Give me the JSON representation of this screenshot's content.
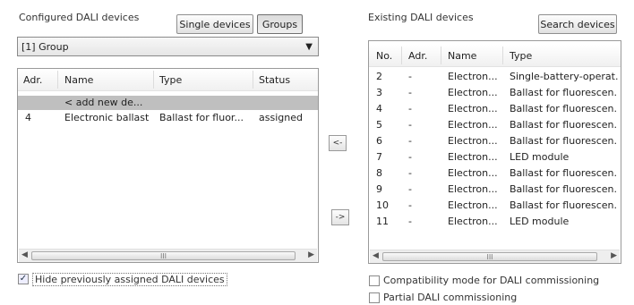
{
  "left": {
    "title": "Configured DALI devices",
    "single_devices_label": "Single devices",
    "groups_label": "Groups",
    "group_combo_value": "[1] Group",
    "columns": [
      "Adr.",
      "Name",
      "Type",
      "Status"
    ],
    "rows": [
      {
        "adr": "",
        "name": "< add new de...",
        "type": "",
        "status": ""
      },
      {
        "adr": "4",
        "name": "Electronic ballast",
        "type": "Ballast for fluor...",
        "status": "assigned"
      }
    ],
    "hide_checkbox_label": "Hide previously assigned DALI devices",
    "hide_checked": true,
    "scroll_thumb_glyph": "III"
  },
  "middle": {
    "move_left_label": "<-",
    "move_right_label": "->"
  },
  "right": {
    "title": "Existing DALI devices",
    "search_label": "Search devices",
    "columns": [
      "No.",
      "Adr.",
      "Name",
      "Type"
    ],
    "rows": [
      {
        "no": "2",
        "adr": "-",
        "name": "Electron...",
        "type": "Single-battery-operat."
      },
      {
        "no": "3",
        "adr": "-",
        "name": "Electron...",
        "type": "Ballast for fluorescen."
      },
      {
        "no": "4",
        "adr": "-",
        "name": "Electron...",
        "type": "Ballast for fluorescen."
      },
      {
        "no": "5",
        "adr": "-",
        "name": "Electron...",
        "type": "Ballast for fluorescen."
      },
      {
        "no": "6",
        "adr": "-",
        "name": "Electron...",
        "type": "Ballast for fluorescen."
      },
      {
        "no": "7",
        "adr": "-",
        "name": "Electron...",
        "type": "LED module"
      },
      {
        "no": "8",
        "adr": "-",
        "name": "Electron...",
        "type": "Ballast for fluorescen."
      },
      {
        "no": "9",
        "adr": "-",
        "name": "Electron...",
        "type": "Ballast for fluorescen."
      },
      {
        "no": "10",
        "adr": "-",
        "name": "Electron...",
        "type": "Ballast for fluorescen."
      },
      {
        "no": "11",
        "adr": "-",
        "name": "Electron...",
        "type": "LED module"
      }
    ],
    "compat_label": "Compatibility mode for DALI commissioning",
    "compat_checked": false,
    "partial_label": "Partial DALI commissioning",
    "partial_checked": false,
    "scroll_thumb_glyph": "III"
  }
}
